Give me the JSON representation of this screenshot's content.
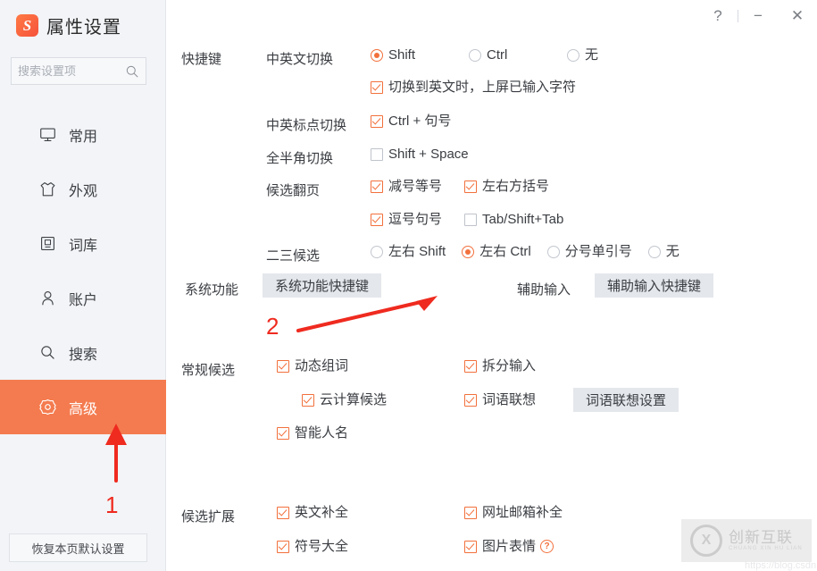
{
  "window": {
    "title": "属性设置",
    "logo_icon": "sogou-logo-icon",
    "controls": [
      {
        "name": "help-button",
        "glyph": "?"
      },
      {
        "name": "minimize-button",
        "glyph": "−"
      },
      {
        "name": "close-button",
        "glyph": "✕"
      }
    ]
  },
  "sidebar": {
    "search": {
      "value": "",
      "placeholder": "搜索设置项",
      "icon": "search-icon"
    },
    "items": [
      {
        "label": "常用",
        "icon": "monitor-icon",
        "active": false
      },
      {
        "label": "外观",
        "icon": "shirt-icon",
        "active": false
      },
      {
        "label": "词库",
        "icon": "book-icon",
        "active": false
      },
      {
        "label": "账户",
        "icon": "user-icon",
        "active": false
      },
      {
        "label": "搜索",
        "icon": "search-icon",
        "active": false
      },
      {
        "label": "高级",
        "icon": "gear-icon",
        "active": true
      }
    ],
    "reset_button": "恢复本页默认设置"
  },
  "main": {
    "shortcut": {
      "title": "快捷键",
      "cn_en_switch": {
        "label": "中英文切换",
        "options": [
          {
            "label": "Shift",
            "checked": true
          },
          {
            "label": "Ctrl",
            "checked": false
          },
          {
            "label": "无",
            "checked": false
          }
        ],
        "sub_checkbox": {
          "label": "切换到英文时，上屏已输入字符",
          "checked": true
        }
      },
      "punct_switch": {
        "label": "中英标点切换",
        "checkbox": {
          "label": "Ctrl + 句号",
          "checked": true
        }
      },
      "width_switch": {
        "label": "全半角切换",
        "checkbox": {
          "label": "Shift + Space",
          "checked": false
        }
      },
      "page_turn": {
        "label": "候选翻页",
        "row1": [
          {
            "label": "减号等号",
            "checked": true
          },
          {
            "label": "左右方括号",
            "checked": true
          }
        ],
        "row2": [
          {
            "label": "逗号句号",
            "checked": true
          },
          {
            "label": "Tab/Shift+Tab",
            "checked": false
          }
        ]
      },
      "second_third": {
        "label": "二三候选",
        "options": [
          {
            "label": "左右 Shift",
            "checked": false
          },
          {
            "label": "左右 Ctrl",
            "checked": true
          },
          {
            "label": "分号单引号",
            "checked": false
          },
          {
            "label": "无",
            "checked": false
          }
        ]
      },
      "system_function": {
        "label": "系统功能",
        "button": "系统功能快捷键"
      },
      "assist_input": {
        "label": "辅助输入",
        "button": "辅助输入快捷键"
      }
    },
    "normal_candidates": {
      "title": "常规候选",
      "col1": [
        {
          "label": "动态组词",
          "checked": true,
          "indent": false
        },
        {
          "label": "云计算候选",
          "checked": true,
          "indent": true
        },
        {
          "label": "智能人名",
          "checked": true,
          "indent": false
        }
      ],
      "col2": [
        {
          "label": "拆分输入",
          "checked": true
        },
        {
          "label": "词语联想",
          "checked": true
        }
      ],
      "assoc_button": "词语联想设置"
    },
    "candidate_extension": {
      "title": "候选扩展",
      "col1": [
        {
          "label": "英文补全",
          "checked": true
        },
        {
          "label": "符号大全",
          "checked": true
        }
      ],
      "col2": [
        {
          "label": "网址邮箱补全",
          "checked": true,
          "help": false
        },
        {
          "label": "图片表情",
          "checked": true,
          "help": true
        }
      ]
    }
  },
  "annotations": [
    {
      "number": "1",
      "target": "sidebar-item-高级"
    },
    {
      "number": "2",
      "target": "system-function-shortcut-button"
    }
  ],
  "watermark": {
    "cn": "创新互联",
    "en": "CHUANG XIN HU LIAN",
    "url": "https://blog.csdn."
  },
  "colors": {
    "accent": "#f2703c",
    "active_nav": "#f47b4f",
    "annotation": "#ef2a1f",
    "sidebar_bg": "#f2f4f7",
    "button_bg": "#e4e7eb"
  }
}
